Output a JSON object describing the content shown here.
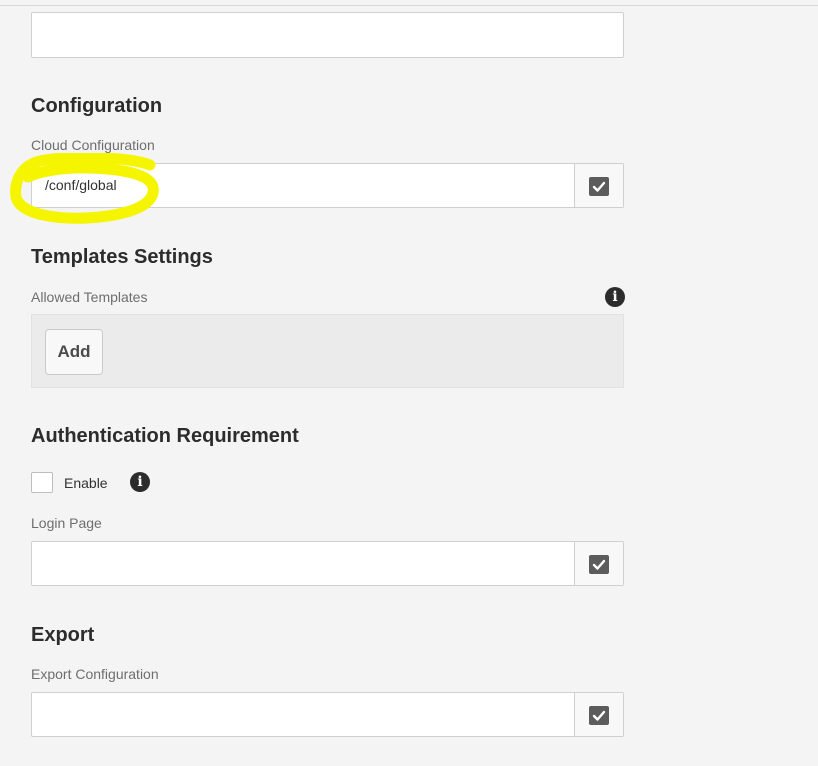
{
  "sections": {
    "configuration": {
      "heading": "Configuration",
      "cloud_label": "Cloud Configuration",
      "cloud_value": "/conf/global"
    },
    "templates": {
      "heading": "Templates Settings",
      "allowed_label": "Allowed Templates",
      "add_label": "Add"
    },
    "authentication": {
      "heading": "Authentication Requirement",
      "enable_label": "Enable",
      "login_label": "Login Page",
      "login_value": ""
    },
    "export": {
      "heading": "Export",
      "export_label": "Export Configuration",
      "export_value": ""
    }
  },
  "top_field_value": "",
  "icons": {
    "info": "info-icon",
    "picker": "check-icon"
  },
  "colors": {
    "highlight": "#f5f500",
    "background": "#f4f4f4"
  }
}
